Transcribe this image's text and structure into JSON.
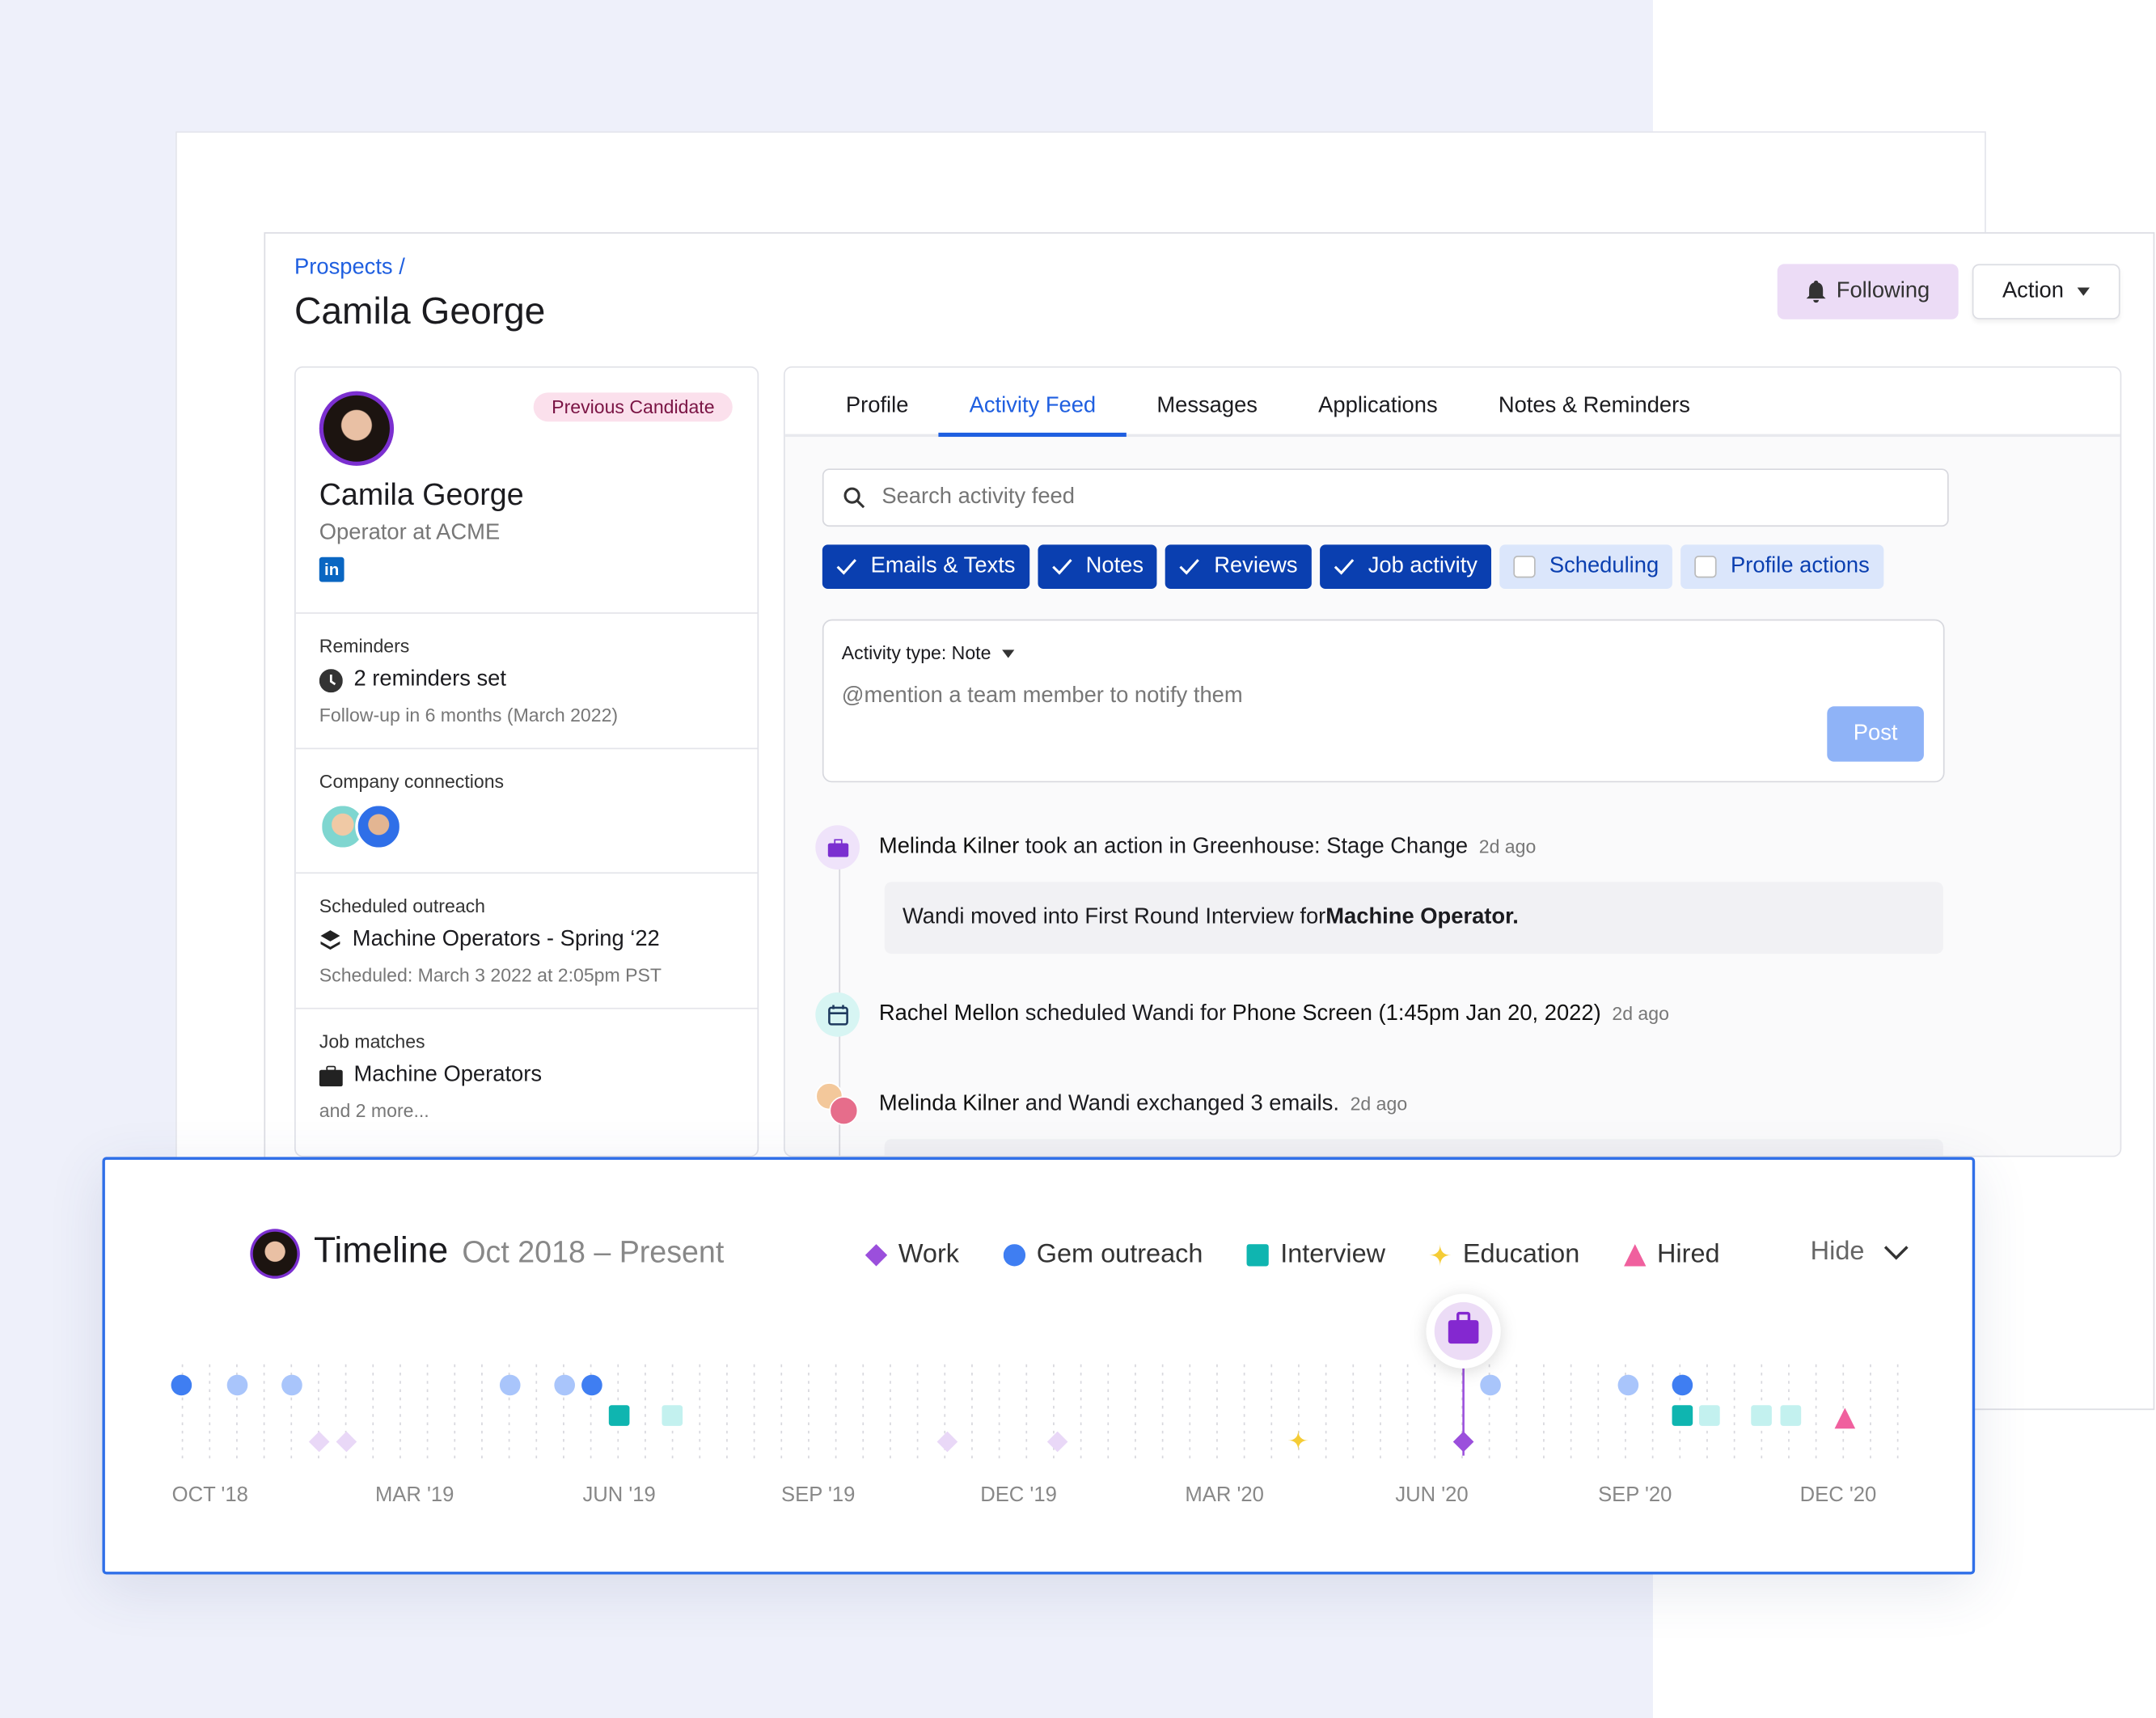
{
  "header": {
    "breadcrumb": "Prospects /",
    "title": "Camila George",
    "following_label": "Following",
    "action_label": "Action"
  },
  "profile": {
    "badge": "Previous Candidate",
    "name": "Camila George",
    "headline": "Operator at ACME",
    "linkedin_icon": "linkedin-icon",
    "reminders": {
      "label": "Reminders",
      "value": "2 reminders set",
      "sub": "Follow-up in 6 months (March 2022)"
    },
    "connections": {
      "label": "Company connections"
    },
    "outreach": {
      "label": "Scheduled outreach",
      "value": "Machine Operators - Spring ‘22",
      "sub": "Scheduled: March 3 2022 at 2:05pm PST"
    },
    "jobs": {
      "label": "Job matches",
      "value": "Machine Operators",
      "sub": "and 2 more..."
    }
  },
  "tabs": [
    {
      "label": "Profile"
    },
    {
      "label": "Activity Feed",
      "active": true
    },
    {
      "label": "Messages"
    },
    {
      "label": "Applications"
    },
    {
      "label": "Notes & Reminders"
    }
  ],
  "search": {
    "placeholder": "Search activity feed"
  },
  "filters": [
    {
      "label": "Emails & Texts",
      "checked": true
    },
    {
      "label": "Notes",
      "checked": true
    },
    {
      "label": "Reviews",
      "checked": true
    },
    {
      "label": "Job activity",
      "checked": true
    },
    {
      "label": "Scheduling",
      "checked": false
    },
    {
      "label": "Profile actions",
      "checked": false
    }
  ],
  "composer": {
    "activity_type": "Activity type: Note",
    "placeholder": "@mention a team member to notify them",
    "post_label": "Post"
  },
  "feed": [
    {
      "actor": "Melinda Kilner",
      "text": " took an action in Greenhouse: Stage Change",
      "time": "2d ago",
      "detail_pre": "Wandi moved into First Round Interview for ",
      "detail_bold": "Machine Operator."
    },
    {
      "actor": "Rachel Mellon",
      "text": " scheduled Wandi for ",
      "bold": "Phone Screen (1:45pm Jan 20, 2022)",
      "time": "2d ago"
    },
    {
      "actor": "Melinda Kilner",
      "text": " and Wandi exchanged 3 emails.",
      "time": "2d ago"
    }
  ],
  "timeline": {
    "title": "Timeline",
    "range": "Oct 2018 – Present",
    "hide_label": "Hide",
    "legend": [
      {
        "label": "Work",
        "color": "#9b4fdc",
        "shape": "diamond"
      },
      {
        "label": "Gem outreach",
        "color": "#3f7ef2",
        "shape": "circle"
      },
      {
        "label": "Interview",
        "color": "#0fb5b0",
        "shape": "square"
      },
      {
        "label": "Education",
        "color": "#f5cc35",
        "shape": "star"
      },
      {
        "label": "Hired",
        "color": "#f0609e",
        "shape": "triangle"
      }
    ]
  },
  "chart_data": {
    "type": "scatter",
    "x_ticks": [
      "OCT '18",
      "MAR '19",
      "JUN '19",
      "SEP '19",
      "DEC '19",
      "MAR '20",
      "JUN '20",
      "SEP '20",
      "DEC '20"
    ],
    "x_tick_dates": [
      "2018-10-01",
      "2019-03-01",
      "2019-06-01",
      "2019-09-01",
      "2019-12-01",
      "2020-03-01",
      "2020-06-01",
      "2020-09-01",
      "2020-12-01"
    ],
    "grid": true,
    "events": [
      {
        "type": "Gem outreach",
        "date": "2018-09-10",
        "highlighted": true
      },
      {
        "type": "Gem outreach",
        "date": "2018-10-21",
        "highlighted": false
      },
      {
        "type": "Gem outreach",
        "date": "2018-12-01",
        "highlighted": false
      },
      {
        "type": "Work",
        "date": "2018-12-21",
        "highlighted": false
      },
      {
        "type": "Work",
        "date": "2019-01-11",
        "highlighted": false
      },
      {
        "type": "Gem outreach",
        "date": "2019-04-13",
        "highlighted": false
      },
      {
        "type": "Gem outreach",
        "date": "2019-05-07",
        "highlighted": false
      },
      {
        "type": "Gem outreach",
        "date": "2019-05-19",
        "highlighted": true
      },
      {
        "type": "Interview",
        "date": "2019-06-01",
        "highlighted": true
      },
      {
        "type": "Interview",
        "date": "2019-06-25",
        "highlighted": false
      },
      {
        "type": "Work",
        "date": "2019-10-29",
        "highlighted": false
      },
      {
        "type": "Work",
        "date": "2019-12-18",
        "highlighted": false
      },
      {
        "type": "Education",
        "date": "2020-04-03",
        "highlighted": true
      },
      {
        "type": "Work",
        "date": "2020-06-15",
        "highlighted": true,
        "selected": true
      },
      {
        "type": "Gem outreach",
        "date": "2020-06-27",
        "highlighted": false
      },
      {
        "type": "Gem outreach",
        "date": "2020-08-28",
        "highlighted": false
      },
      {
        "type": "Gem outreach",
        "date": "2020-09-22",
        "highlighted": true
      },
      {
        "type": "Interview",
        "date": "2020-09-22",
        "highlighted": true
      },
      {
        "type": "Interview",
        "date": "2020-10-04",
        "highlighted": false
      },
      {
        "type": "Interview",
        "date": "2020-10-27",
        "highlighted": false
      },
      {
        "type": "Interview",
        "date": "2020-11-10",
        "highlighted": false
      },
      {
        "type": "Hired",
        "date": "2020-12-04",
        "highlighted": true
      }
    ]
  }
}
